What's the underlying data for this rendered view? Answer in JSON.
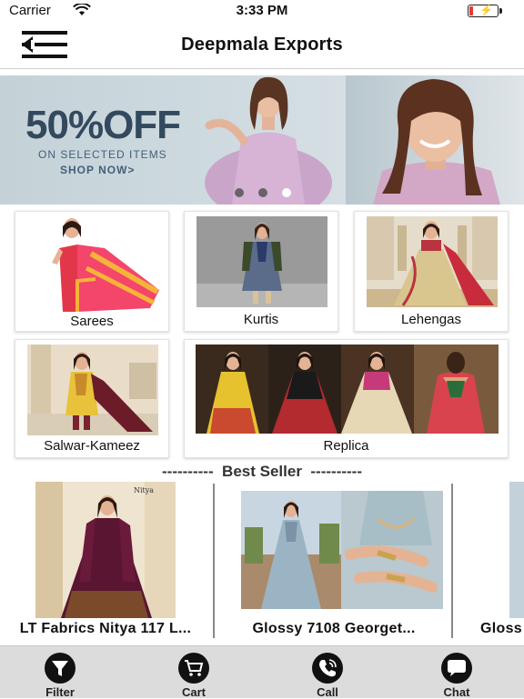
{
  "status_bar": {
    "carrier": "Carrier",
    "time": "3:33 PM",
    "battery_color": "#e53935"
  },
  "navbar": {
    "title": "Deepmala Exports",
    "menu_icon": "menu-back-icon"
  },
  "banner": {
    "headline": "50%OFF",
    "subline": "ON SELECTED ITEMS",
    "cta": "SHOP NOW>",
    "text_color": "#33495e",
    "slides_total": 3,
    "active_slide": 3
  },
  "categories": [
    {
      "label": "Sarees"
    },
    {
      "label": "Kurtis"
    },
    {
      "label": "Lehengas"
    },
    {
      "label": "Salwar-Kameez"
    },
    {
      "label": "Replica"
    }
  ],
  "best_seller": {
    "title": "----------  Best Seller  ----------",
    "products": [
      {
        "name": "LT Fabrics Nitya 117 L..."
      },
      {
        "name": "Glossy 7108 Georget..."
      },
      {
        "name": "Gloss"
      }
    ]
  },
  "tabbar": {
    "background": "#dcdcdc",
    "items": [
      {
        "label": "Filter",
        "icon": "filter-icon"
      },
      {
        "label": "Cart",
        "icon": "cart-icon"
      },
      {
        "label": "Call",
        "icon": "phone-icon"
      },
      {
        "label": "Chat",
        "icon": "chat-icon"
      }
    ]
  }
}
